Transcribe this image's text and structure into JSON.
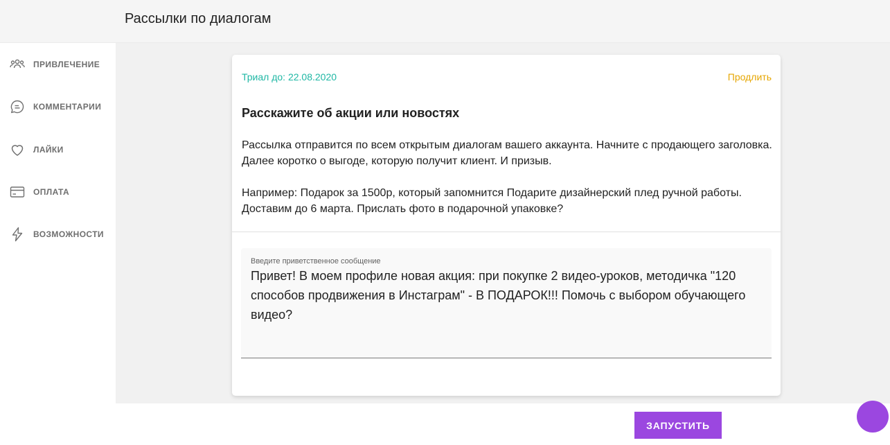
{
  "header": {
    "title": "Рассылки по диалогам"
  },
  "sidebar": {
    "items": [
      {
        "label": "ПРИВЛЕЧЕНИЕ",
        "icon": "users-icon"
      },
      {
        "label": "КОММЕНТАРИИ",
        "icon": "comment-icon"
      },
      {
        "label": "ЛАЙКИ",
        "icon": "heart-icon"
      },
      {
        "label": "ОПЛАТА",
        "icon": "credit-card-icon"
      },
      {
        "label": "ВОЗМОЖНОСТИ",
        "icon": "lightning-icon"
      }
    ]
  },
  "card": {
    "trial": "Триал до: 22.08.2020",
    "extend": "Продлить",
    "heading": "Расскажите об акции или новостях",
    "paragraph1": "Рассылка отправится по всем открытым диалогам вашего аккаунта. Начните с продающего заголовка. Далее коротко о выгоде, которую получит клиент. И призыв.",
    "paragraph2": "Например: Подарок за 1500р, который запомнится Подарите дизайнерский плед ручной работы. Доставим до 6 марта. Прислать фото в подарочной упаковке?"
  },
  "message_field": {
    "label": "Введите приветственное сообщение",
    "value": "Привет! В моем профиле новая акция: при покупке 2 видео-уроков, методичка \"120 способов продвижения в Инстаграм\" - В ПОДАРОК!!! Помочь с выбором обучающего видео?"
  },
  "actions": {
    "launch": "ЗАПУСТИТЬ"
  },
  "colors": {
    "accent": "#9b47e0",
    "trial": "#1eb7a4",
    "extend": "#e6a600"
  }
}
